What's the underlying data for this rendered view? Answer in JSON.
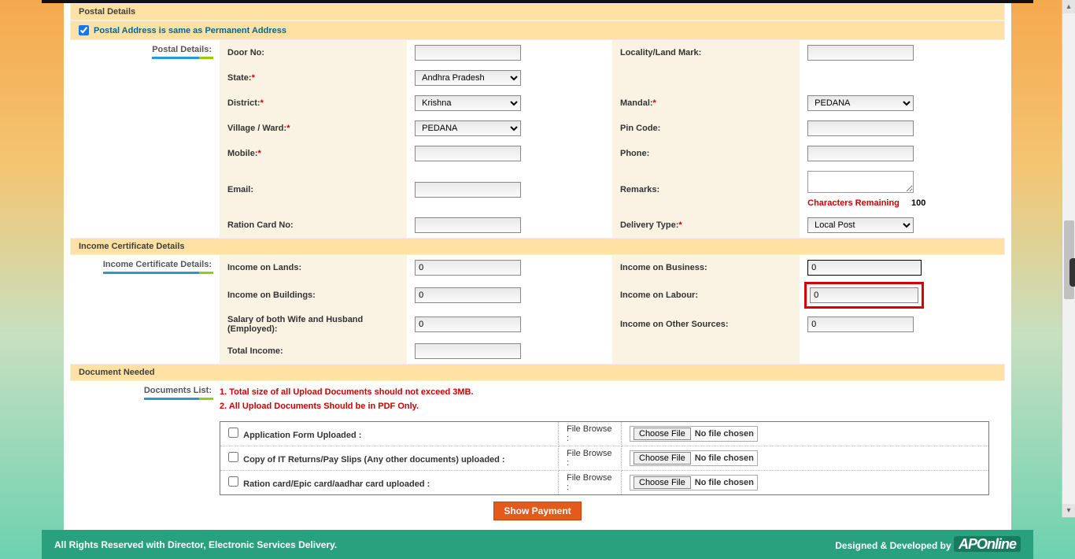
{
  "postalSection": {
    "title": "Postal Details",
    "sameAsLabel": "Postal Address is same as Permanent Address",
    "sideLabel": "Postal Details:",
    "fields": {
      "doorNo": "Door No:",
      "locality": "Locality/Land Mark:",
      "state": "State:",
      "stateVal": "Andhra Pradesh",
      "district": "District:",
      "districtVal": "Krishna",
      "mandal": "Mandal:",
      "mandalVal": "PEDANA",
      "village": "Village / Ward:",
      "villageVal": "PEDANA",
      "pin": "Pin Code:",
      "mobile": "Mobile:",
      "phone": "Phone:",
      "email": "Email:",
      "remarks": "Remarks:",
      "charRemain": "Characters Remaining",
      "charCount": "100",
      "ration": "Ration Card No:",
      "delivery": "Delivery Type:",
      "deliveryVal": "Local Post"
    }
  },
  "incomeSection": {
    "title": "Income Certificate Details",
    "sideLabel": "Income Certificate Details:",
    "fields": {
      "lands": "Income on Lands:",
      "business": "Income on Business:",
      "buildings": "Income on Buildings:",
      "labour": "Income on Labour:",
      "salary": "Salary of both Wife and Husband (Employed):",
      "other": "Income on Other Sources:",
      "total": "Total Income:",
      "zero": "0"
    }
  },
  "docSection": {
    "title": "Document Needed",
    "sideLabel": "Documents List:",
    "note1": "1. Total size of all Upload Documents should not exceed 3MB.",
    "note2": "2. All Upload Documents Should be in PDF Only.",
    "rows": [
      "Application Form Uploaded :",
      "Copy of IT Returns/Pay Slips (Any other documents) uploaded :",
      "Ration card/Epic card/aadhar card uploaded :"
    ],
    "browseLabel": "File Browse :",
    "chooseFile": "Choose File",
    "noFile": "No file chosen"
  },
  "showPayment": "Show Payment",
  "footer": {
    "left": "All Rights Reserved with Director, Electronic Services Delivery.",
    "right": "Designed & Developed by",
    "brand": "APOnline"
  }
}
